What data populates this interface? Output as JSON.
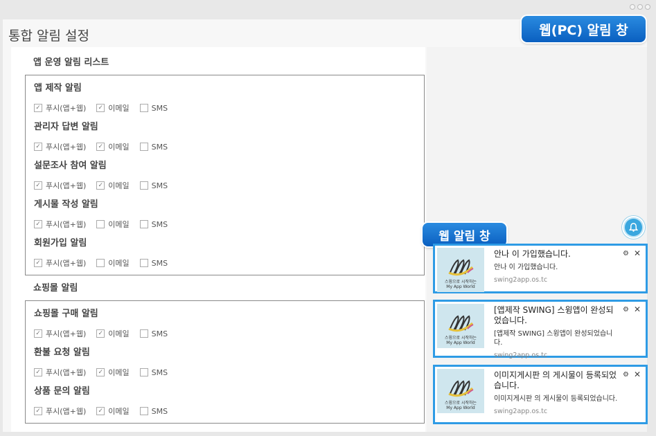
{
  "page_title": "통합 알림 설정",
  "badges": {
    "pc_window": "웹(PC) 알림 창",
    "web_window": "웹 알림 창"
  },
  "sections": [
    {
      "title": "앱 운영 알림 리스트",
      "items": [
        {
          "title": "앱 제작 알림",
          "push": true,
          "email": true,
          "sms": false
        },
        {
          "title": "관리자 답변 알림",
          "push": true,
          "email": true,
          "sms": false
        },
        {
          "title": "설문조사 참여 알림",
          "push": true,
          "email": true,
          "sms": false
        },
        {
          "title": "게시물 작성 알림",
          "push": true,
          "email": false,
          "sms": false
        },
        {
          "title": "회원가입 알림",
          "push": true,
          "email": false,
          "sms": false
        }
      ]
    },
    {
      "title": "쇼핑몰 알림",
      "items": [
        {
          "title": "쇼핑몰 구매 알림",
          "push": true,
          "email": true,
          "sms": false
        },
        {
          "title": "환불 요청 알림",
          "push": true,
          "email": true,
          "sms": false
        },
        {
          "title": "상품 문의 알림",
          "push": true,
          "email": true,
          "sms": false
        }
      ]
    }
  ],
  "option_labels": {
    "push": "푸시(앱+웹)",
    "email": "이메일",
    "sms": "SMS"
  },
  "notifications": [
    {
      "title": "안나 이 가입했습니다.",
      "body": "안나 이 가입했습니다.",
      "origin": "swing2app.os.tc",
      "thumb_line1": "스윙으로 시작하는",
      "thumb_line2": "My App World"
    },
    {
      "title": "[앱제작 SWING] 스윙앱이 완성되었습니다.",
      "body": "[앱제작 SWING] 스윙앱이 완성되었습니다.",
      "origin": "swing2app.os.tc",
      "thumb_line1": "스윙으로 시작하는",
      "thumb_line2": "My App World"
    },
    {
      "title": "이미지게시판 의 게시물이 등록되었습니다.",
      "body": "이미지게시판 의 게시물이 등록되었습니다.",
      "origin": "swing2app.os.tc",
      "thumb_line1": "스윙으로 시작하는",
      "thumb_line2": "My App World"
    }
  ],
  "icons": {
    "gear": "gear-icon",
    "close": "close-icon",
    "bell": "bell-icon"
  },
  "colors": {
    "accent": "#2e9be5",
    "badge": "#0a5fc0",
    "bell": "#3aa7df"
  }
}
